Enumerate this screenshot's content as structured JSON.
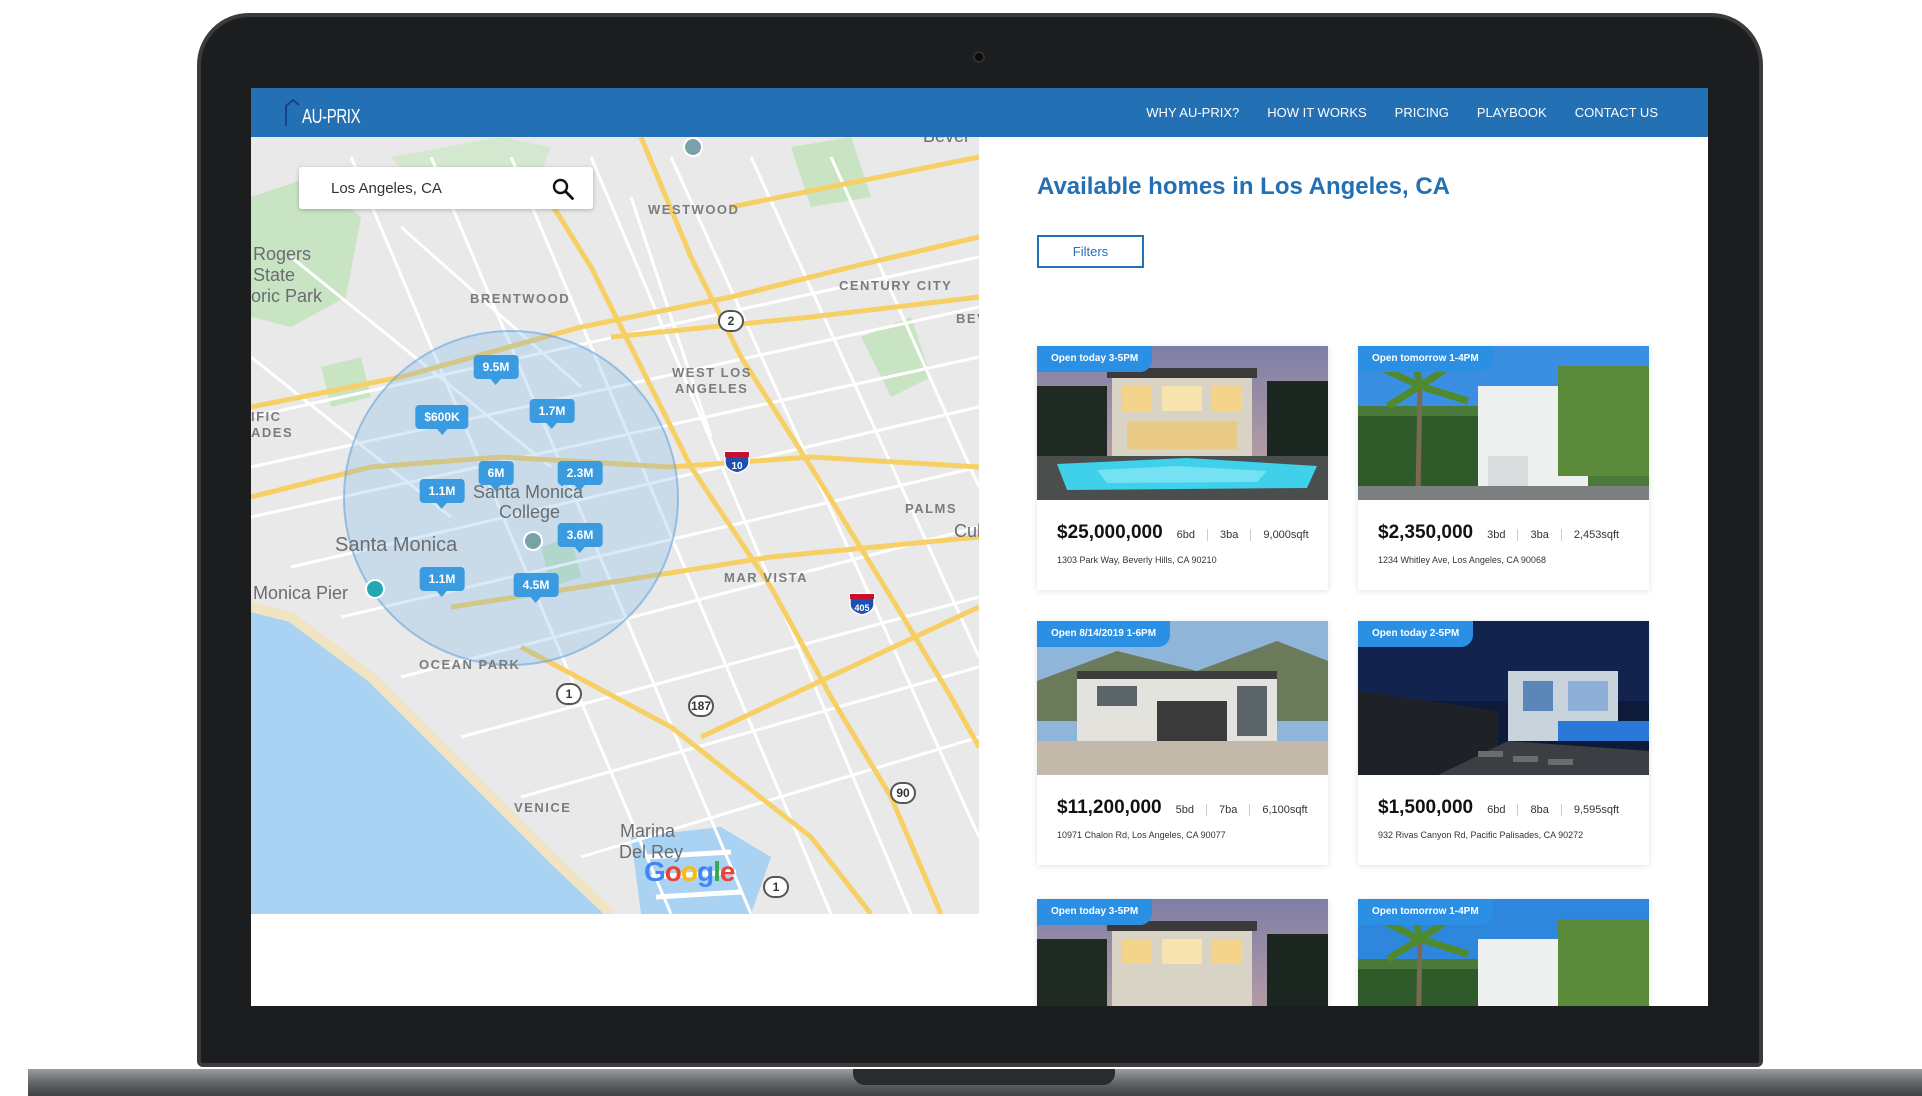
{
  "app": {
    "logo_text": "AU-PRIX"
  },
  "nav": {
    "links": [
      "WHY AU-PRIX?",
      "HOW IT WORKS",
      "PRICING",
      "PLAYBOOK",
      "CONTACT US"
    ]
  },
  "map": {
    "search_value": "Los Angeles, CA",
    "pins": [
      "9.5M",
      "$600K",
      "1.7M",
      "6M",
      "2.3M",
      "1.1M",
      "3.6M",
      "1.1M",
      "4.5M"
    ],
    "labels": {
      "westwood": "WESTWOOD",
      "brentwood": "BRENTWOOD",
      "century_city": "CENTURY CITY",
      "west_la": "WEST LOS",
      "west_la2": "ANGELES",
      "palms": "PALMS",
      "mar_vista": "MAR VISTA",
      "ocean_park": "OCEAN PARK",
      "venice": "VENICE",
      "santa_monica": "Santa Monica",
      "smc1": "Santa Monica",
      "smc2": "College",
      "pier": "Monica Pier",
      "rogers1": "Rogers",
      "rogers2": "State",
      "rogers3": "oric Park",
      "marina1": "Marina",
      "marina2": "Del Rey",
      "pacific1": "IFIC",
      "pacific2": "ADES",
      "bev": "BEV",
      "cul": "Cul",
      "bever": "Bever"
    },
    "shields": {
      "r2": "2",
      "r1a": "1",
      "r187": "187",
      "r90": "90",
      "r1b": "1"
    },
    "interstates": {
      "i10": "10",
      "i405": "405"
    },
    "google": "Google"
  },
  "listings": {
    "title": "Available homes in Los Angeles, CA",
    "filters_label": "Filters",
    "cards": [
      {
        "badge": "Open today 3-5PM",
        "price": "$25,000,000",
        "beds": "6bd",
        "baths": "3ba",
        "sqft": "9,000sqft",
        "address": "1303 Park Way, Beverly Hills, CA 90210"
      },
      {
        "badge": "Open tomorrow 1-4PM",
        "price": "$2,350,000",
        "beds": "3bd",
        "baths": "3ba",
        "sqft": "2,453sqft",
        "address": "1234 Whitley Ave, Los Angeles, CA 90068"
      },
      {
        "badge": "Open 8/14/2019 1-6PM",
        "price": "$11,200,000",
        "beds": "5bd",
        "baths": "7ba",
        "sqft": "6,100sqft",
        "address": "10971 Chalon Rd, Los Angeles, CA 90077"
      },
      {
        "badge": "Open today 2-5PM",
        "price": "$1,500,000",
        "beds": "6bd",
        "baths": "8ba",
        "sqft": "9,595sqft",
        "address": "932 Rivas Canyon Rd, Pacific Palisades, CA 90272"
      },
      {
        "badge": "Open today 3-5PM"
      },
      {
        "badge": "Open tomorrow 1-4PM"
      }
    ]
  },
  "colors": {
    "brand": "#2370b4",
    "pin": "#3a9be0",
    "badge": "#2b90e3"
  }
}
